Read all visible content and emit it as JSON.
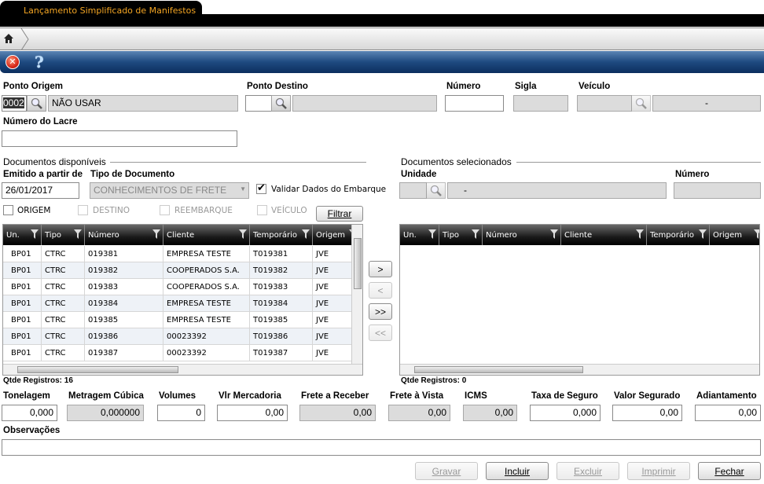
{
  "window": {
    "title": "Lançamento Simplificado de Manifestos"
  },
  "toolbar": {
    "close_icon": "close-icon",
    "help_icon": "help-icon",
    "home_icon": "home-icon"
  },
  "header_fields": {
    "ponto_origem": {
      "label": "Ponto Origem",
      "code": "0002",
      "desc": "NÃO USAR"
    },
    "ponto_destino": {
      "label": "Ponto Destino",
      "code": "",
      "desc": ""
    },
    "numero": {
      "label": "Número",
      "value": ""
    },
    "sigla": {
      "label": "Sigla",
      "value": ""
    },
    "veiculo": {
      "label": "Veículo",
      "code": "",
      "desc": "-"
    },
    "numero_lacre": {
      "label": "Número do Lacre",
      "value": ""
    }
  },
  "disponiveis": {
    "title": "Documentos disponíveis",
    "emitido_label": "Emitido a partir de",
    "emitido_value": "26/01/2017",
    "tipo_label": "Tipo de Documento",
    "tipo_value": "CONHECIMENTOS DE FRETE",
    "validar_label": "Validar Dados do Embarque",
    "validar_checked": true,
    "checks": [
      {
        "label": "ORIGEM",
        "enabled": true
      },
      {
        "label": "DESTINO",
        "enabled": false
      },
      {
        "label": "REEMBARQUE",
        "enabled": false
      },
      {
        "label": "VEÍCULO",
        "enabled": false
      }
    ],
    "filtrar_label": "Filtrar",
    "columns": [
      "Un.",
      "Tipo",
      "Número",
      "Cliente",
      "Temporário",
      "Origem"
    ],
    "rows": [
      [
        "BP01",
        "CTRC",
        "019381",
        "EMPRESA TESTE",
        "T019381",
        "JVE"
      ],
      [
        "BP01",
        "CTRC",
        "019382",
        "COOPERADOS S.A.",
        "T019382",
        "JVE"
      ],
      [
        "BP01",
        "CTRC",
        "019383",
        "COOPERADOS S.A.",
        "T019383",
        "JVE"
      ],
      [
        "BP01",
        "CTRC",
        "019384",
        "EMPRESA TESTE",
        "T019384",
        "JVE"
      ],
      [
        "BP01",
        "CTRC",
        "019385",
        "EMPRESA TESTE",
        "T019385",
        "JVE"
      ],
      [
        "BP01",
        "CTRC",
        "019386",
        "00023392",
        "T019386",
        "JVE"
      ],
      [
        "BP01",
        "CTRC",
        "019387",
        "00023392",
        "T019387",
        "JVE"
      ]
    ],
    "count_label": "Qtde Registros: 16"
  },
  "transfer": {
    "add": ">",
    "remove": "<",
    "add_all": ">>",
    "remove_all": "<<"
  },
  "selecionados": {
    "title": "Documentos selecionados",
    "unidade_label": "Unidade",
    "unidade_code": "",
    "unidade_desc": "-",
    "numero_label": "Número",
    "numero_value": "",
    "columns": [
      "Un.",
      "Tipo",
      "Número",
      "Cliente",
      "Temporário",
      "Origem"
    ],
    "count_label": "Qtde Registros: 0"
  },
  "totals": [
    {
      "label": "Tonelagem",
      "value": "0,000",
      "readonly": false
    },
    {
      "label": "Metragem Cúbica",
      "value": "0,000000",
      "readonly": true
    },
    {
      "label": "Volumes",
      "value": "0",
      "readonly": false
    },
    {
      "label": "Vlr Mercadoria",
      "value": "0,00",
      "readonly": false
    },
    {
      "label": "Frete a Receber",
      "value": "0,00",
      "readonly": true
    },
    {
      "label": "Frete à Vista",
      "value": "0,00",
      "readonly": true
    },
    {
      "label": "ICMS",
      "value": "0,00",
      "readonly": true
    },
    {
      "label": "Taxa de Seguro",
      "value": "0,000",
      "readonly": false
    },
    {
      "label": "Valor Segurado",
      "value": "0,00",
      "readonly": false
    },
    {
      "label": "Adiantamento",
      "value": "0,00",
      "readonly": false
    }
  ],
  "observacoes": {
    "label": "Observações",
    "value": ""
  },
  "actions": [
    {
      "label": "Gravar",
      "enabled": false
    },
    {
      "label": "Incluir",
      "enabled": true
    },
    {
      "label": "Excluir",
      "enabled": false
    },
    {
      "label": "Imprimir",
      "enabled": false
    },
    {
      "label": "Fechar",
      "enabled": true
    }
  ],
  "colors": {
    "title_text": "#f5a623",
    "toolbar_blue": "#1e4a80"
  }
}
